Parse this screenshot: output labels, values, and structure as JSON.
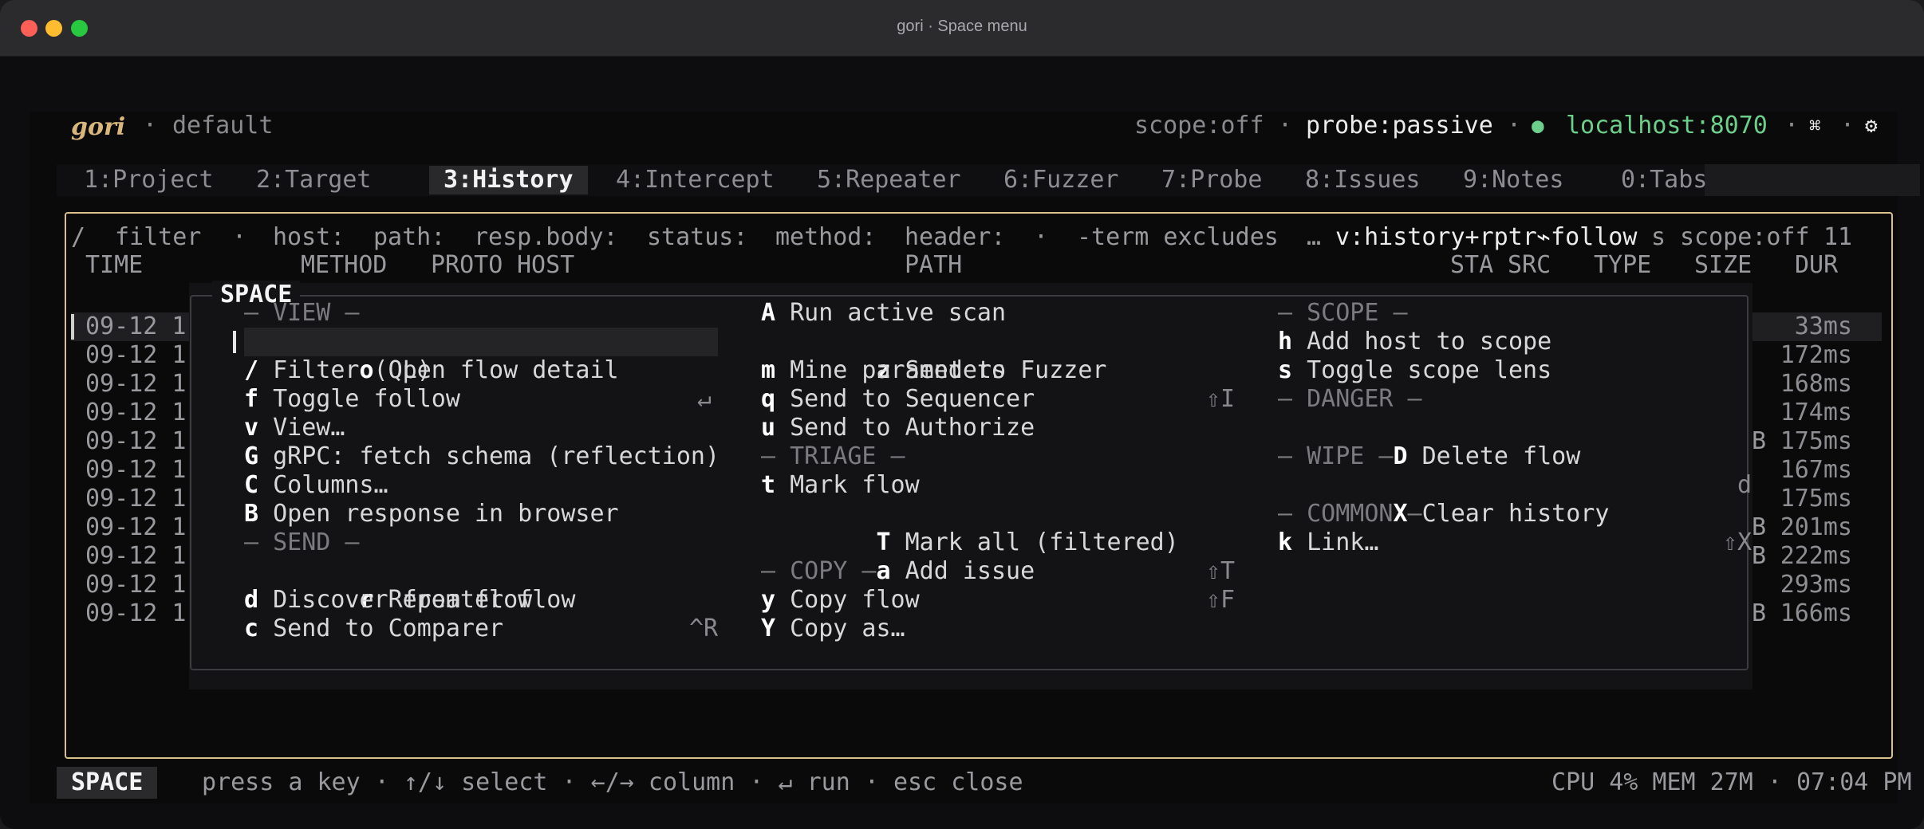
{
  "window": {
    "title": "gori · Space menu"
  },
  "header": {
    "brand": "gori",
    "sep": "·",
    "project": "default",
    "scope": "scope:off",
    "probe": "probe:passive",
    "status_dot": "●",
    "host": "localhost:8070",
    "cmd_icon": "⌘",
    "gear_icon": "⚙"
  },
  "tabs": [
    {
      "label": "1:Project"
    },
    {
      "label": "2:Target"
    },
    {
      "label": "3:History",
      "active": true
    },
    {
      "label": "4:Intercept"
    },
    {
      "label": "5:Repeater"
    },
    {
      "label": "6:Fuzzer"
    },
    {
      "label": "7:Probe"
    },
    {
      "label": "8:Issues"
    },
    {
      "label": "9:Notes"
    },
    {
      "label": "0:Tabs"
    }
  ],
  "filterbar": {
    "slash": "/",
    "filter": "filter",
    "dot": "·",
    "host": "host:",
    "path": "path:",
    "respbody": "resp.body:",
    "status": "status:",
    "method": "method:",
    "header": "header:",
    "term": "-term excludes",
    "ellipsis": "…",
    "view": "v:history+rptr",
    "follow": "⌁follow",
    "s": "s",
    "scope": "scope:off",
    "count": "11"
  },
  "columns": {
    "time": "TIME",
    "method": "METHOD",
    "proto": "PROTO",
    "host": "HOST",
    "path": "PATH",
    "sta": "STA",
    "src": "SRC",
    "type": "TYPE",
    "size": "SIZE",
    "dur": "DUR"
  },
  "rows": [
    {
      "time": "09-12 1",
      "size": "",
      "dur": "33ms"
    },
    {
      "time": "09-12 1",
      "size": "",
      "dur": "172ms"
    },
    {
      "time": "09-12 1",
      "size": "",
      "dur": "168ms"
    },
    {
      "time": "09-12 1",
      "size": "",
      "dur": "174ms"
    },
    {
      "time": "09-12 1",
      "size": "B",
      "dur": "175ms"
    },
    {
      "time": "09-12 1",
      "size": "",
      "dur": "167ms"
    },
    {
      "time": "09-12 1",
      "size": "",
      "dur": "175ms"
    },
    {
      "time": "09-12 1",
      "size": "B",
      "dur": "201ms"
    },
    {
      "time": "09-12 1",
      "size": "B",
      "dur": "222ms"
    },
    {
      "time": "09-12 1",
      "size": "",
      "dur": "293ms"
    },
    {
      "time": "09-12 1",
      "size": "B",
      "dur": "166ms"
    }
  ],
  "popup": {
    "title": "SPACE",
    "col1": [
      {
        "section": "— VIEW —"
      },
      {
        "key": "o",
        "label": "Open flow detail",
        "shortcut": "↵",
        "selected": true
      },
      {
        "key": "/",
        "label": "Filter (QL)"
      },
      {
        "key": "f",
        "label": "Toggle follow"
      },
      {
        "key": "v",
        "label": "View…"
      },
      {
        "key": "G",
        "label": "gRPC: fetch schema (reflection)"
      },
      {
        "key": "C",
        "label": "Columns…"
      },
      {
        "key": "B",
        "label": "Open response in browser"
      },
      {
        "section": "— SEND —"
      },
      {
        "key": "r",
        "label": "Repeater flow",
        "shortcut": "^R"
      },
      {
        "key": "d",
        "label": "Discover from flow"
      },
      {
        "key": "c",
        "label": "Send to Comparer"
      }
    ],
    "col2": [
      {
        "key": "A",
        "label": "Run active scan"
      },
      {
        "key": "z",
        "label": "Send to Fuzzer",
        "shortcut": "⇧I"
      },
      {
        "key": "m",
        "label": "Mine parameters"
      },
      {
        "key": "q",
        "label": "Send to Sequencer"
      },
      {
        "key": "u",
        "label": "Send to Authorize"
      },
      {
        "section": "— TRIAGE —"
      },
      {
        "key": "t",
        "label": "Mark flow"
      },
      {
        "key": "T",
        "label": "Mark all (filtered)",
        "shortcut": "⇧T"
      },
      {
        "key": "a",
        "label": "Add issue",
        "shortcut": "⇧F"
      },
      {
        "section": "— COPY —"
      },
      {
        "key": "y",
        "label": "Copy flow"
      },
      {
        "key": "Y",
        "label": "Copy as…"
      }
    ],
    "col3": [
      {
        "section": "— SCOPE —"
      },
      {
        "key": "h",
        "label": "Add host to scope"
      },
      {
        "key": "s",
        "label": "Toggle scope lens"
      },
      {
        "section": "— DANGER —"
      },
      {
        "key": "D",
        "label": "Delete flow",
        "shortcut": "d"
      },
      {
        "section": "— WIPE —"
      },
      {
        "key": "X",
        "label": "Clear history",
        "shortcut": "⇧X"
      },
      {
        "section": "— COMMON —"
      },
      {
        "key": "k",
        "label": "Link…"
      }
    ]
  },
  "statusbar": {
    "mode": "SPACE",
    "hint": "press a key · ↑/↓ select · ←/→ column · ↵ run · esc close",
    "sys": "CPU 4% MEM 27M · 07:04 PM"
  }
}
